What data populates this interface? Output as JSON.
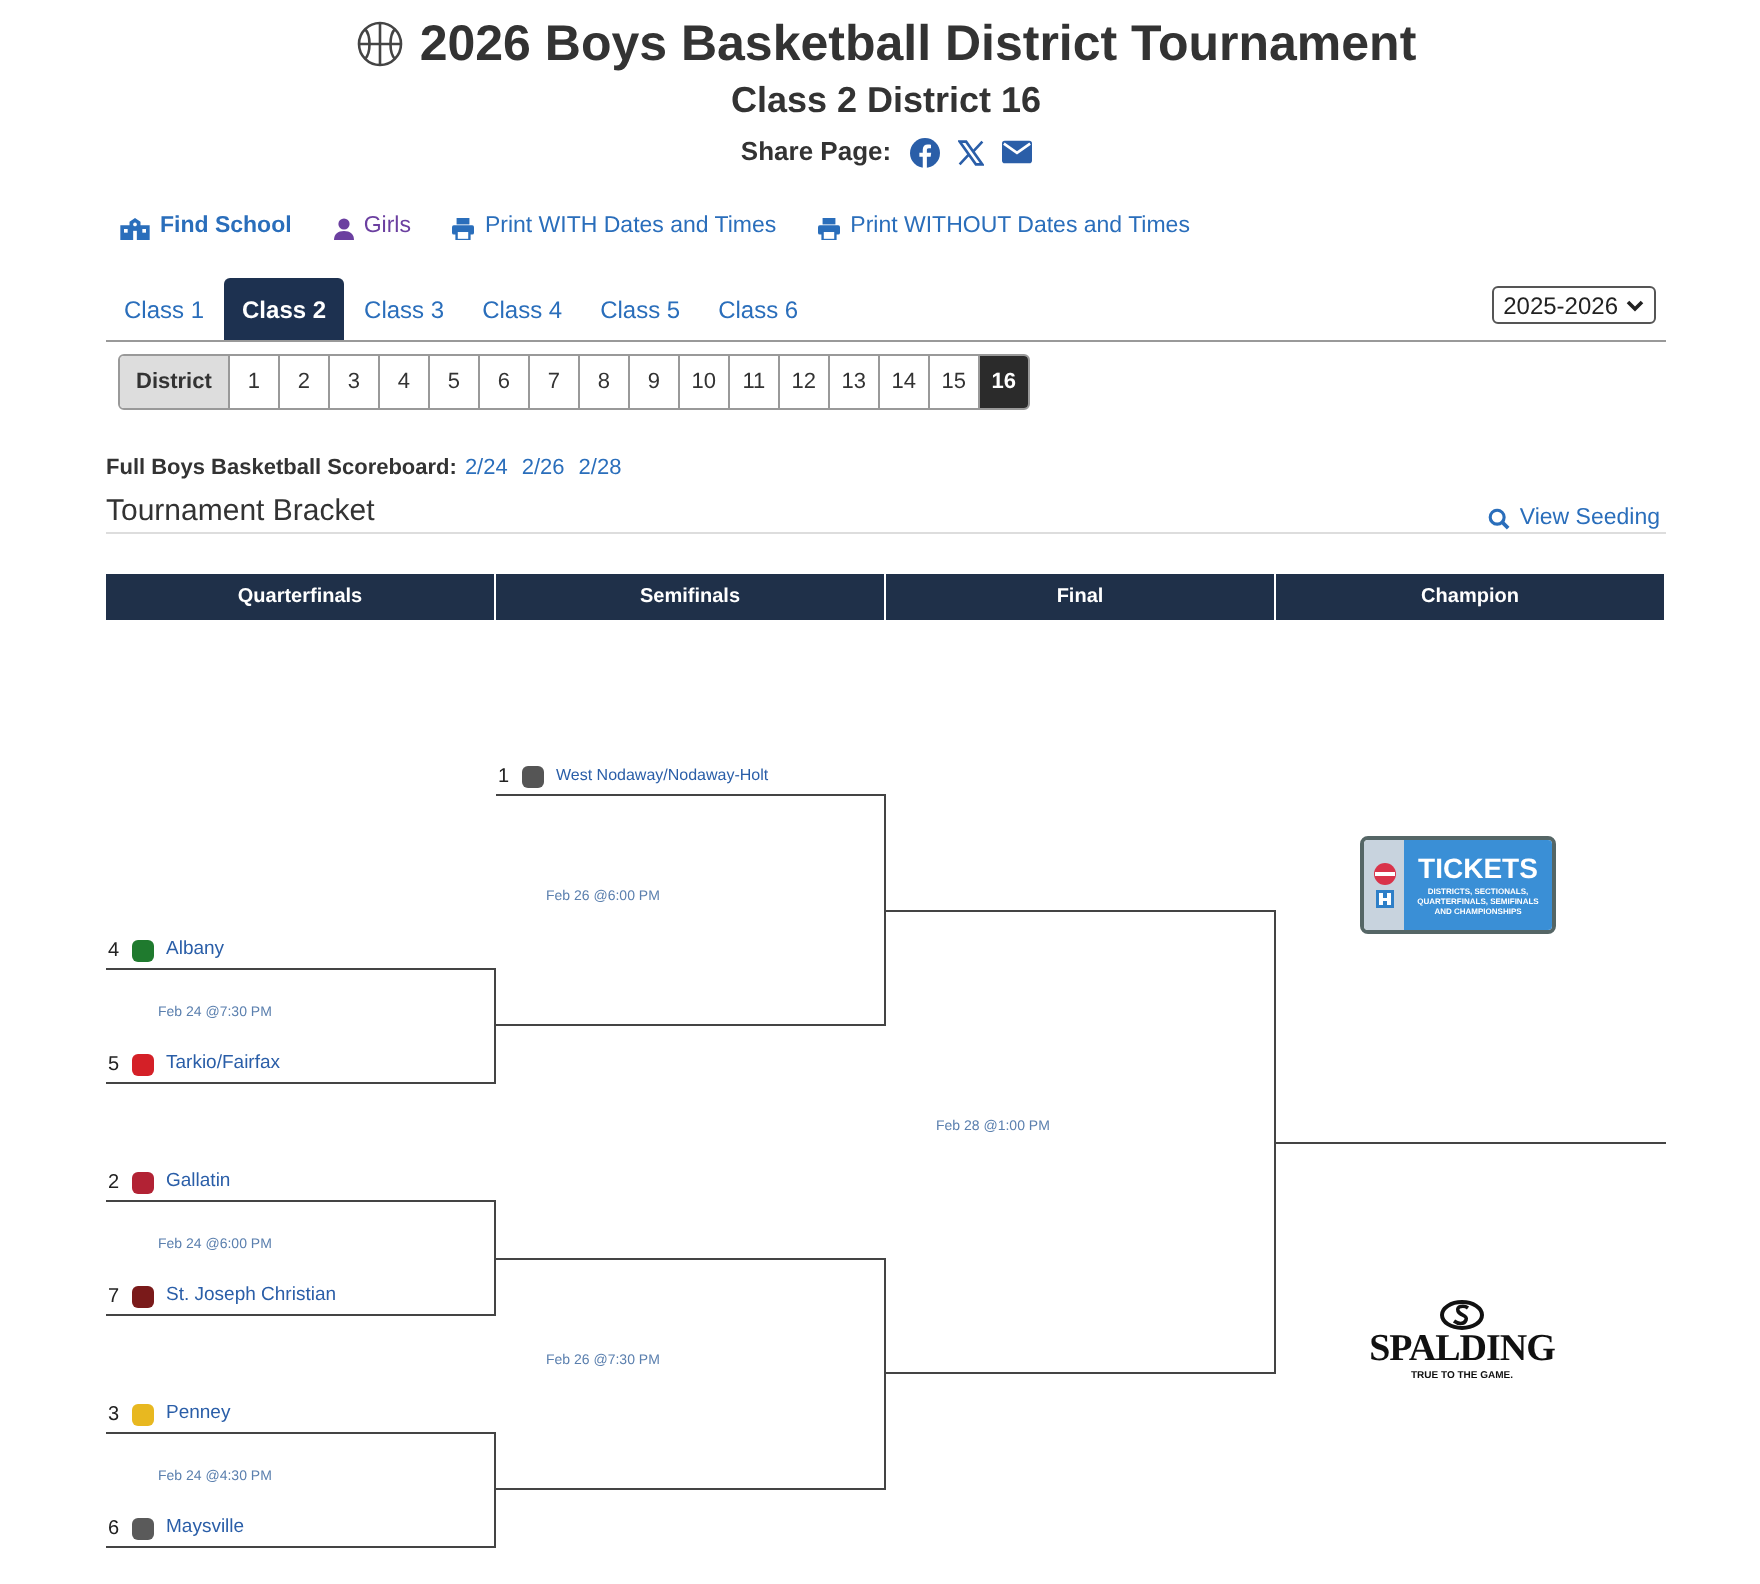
{
  "title": "2026 Boys Basketball District Tournament",
  "subtitle": "Class 2 District 16",
  "share_label": "Share Page:",
  "share_links": [
    {
      "kind": "facebook"
    },
    {
      "kind": "x"
    },
    {
      "kind": "email"
    }
  ],
  "toolbar": [
    {
      "kind": "school",
      "label": "Find School"
    },
    {
      "kind": "person",
      "label": "Girls"
    },
    {
      "kind": "print",
      "label": "Print WITH Dates and Times"
    },
    {
      "kind": "print",
      "label": "Print WITHOUT Dates and Times"
    }
  ],
  "class_tabs": [
    {
      "label": "Class 1",
      "selected": false
    },
    {
      "label": "Class 2",
      "selected": true
    },
    {
      "label": "Class 3",
      "selected": false
    },
    {
      "label": "Class 4",
      "selected": false
    },
    {
      "label": "Class 5",
      "selected": false
    },
    {
      "label": "Class 6",
      "selected": false
    }
  ],
  "season_select": "2025-2026",
  "district_label": "District",
  "districts": [
    {
      "label": "1",
      "selected": false
    },
    {
      "label": "2",
      "selected": false
    },
    {
      "label": "3",
      "selected": false
    },
    {
      "label": "4",
      "selected": false
    },
    {
      "label": "5",
      "selected": false
    },
    {
      "label": "6",
      "selected": false
    },
    {
      "label": "7",
      "selected": false
    },
    {
      "label": "8",
      "selected": false
    },
    {
      "label": "9",
      "selected": false
    },
    {
      "label": "10",
      "selected": false
    },
    {
      "label": "11",
      "selected": false
    },
    {
      "label": "12",
      "selected": false
    },
    {
      "label": "13",
      "selected": false
    },
    {
      "label": "14",
      "selected": false
    },
    {
      "label": "15",
      "selected": false
    },
    {
      "label": "16",
      "selected": true
    }
  ],
  "scoreboard": {
    "label": "Full Boys Basketball Scoreboard:",
    "links": [
      "2/24",
      "2/26",
      "2/28"
    ]
  },
  "section_title": "Tournament Bracket",
  "view_seeding": "View Seeding",
  "bracket": {
    "rounds": [
      "Quarterfinals",
      "Semifinals",
      "Final",
      "Champion"
    ],
    "quarterfinals": [
      {
        "date": "Feb 24 @7:30 PM",
        "teams": [
          {
            "seed": "4",
            "name": "Albany",
            "color": "#1f7a2e"
          },
          {
            "seed": "5",
            "name": "Tarkio/Fairfax",
            "color": "#d42027"
          }
        ]
      },
      {
        "date": "Feb 24 @6:00 PM",
        "teams": [
          {
            "seed": "2",
            "name": "Gallatin",
            "color": "#b22234"
          },
          {
            "seed": "7",
            "name": "St. Joseph Christian",
            "color": "#7a1a1a"
          }
        ]
      },
      {
        "date": "Feb 24 @4:30 PM",
        "teams": [
          {
            "seed": "3",
            "name": "Penney",
            "color": "#e8b820"
          },
          {
            "seed": "6",
            "name": "Maysville",
            "color": "#5a5a5a"
          }
        ]
      }
    ],
    "semifinals": [
      {
        "date": "Feb 26 @6:00 PM",
        "teams": [
          {
            "seed": "1",
            "name": "West Nodaway/Nodaway-Holt",
            "color": "#555555"
          }
        ]
      },
      {
        "date": "Feb 26 @7:30 PM"
      }
    ],
    "final": {
      "date": "Feb 28 @1:00 PM"
    },
    "sponsors": [
      {
        "kind": "tickets",
        "title": "TICKETS",
        "text": "DISTRICTS, SECTIONALS, QUARTERFINALS, SEMIFINALS AND CHAMPIONSHIPS"
      },
      {
        "kind": "spalding",
        "title": "SPALDING",
        "text": "TRUE TO THE GAME."
      }
    ]
  }
}
